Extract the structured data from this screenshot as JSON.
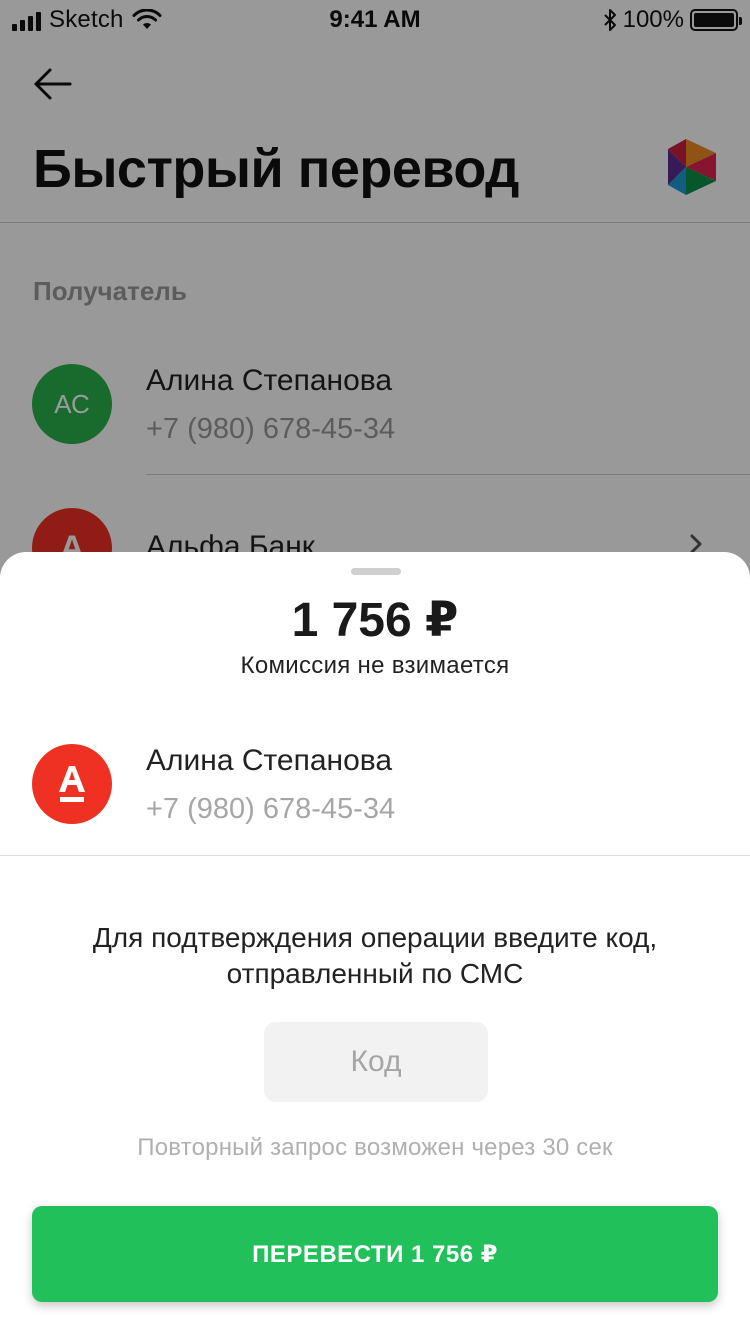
{
  "status_bar": {
    "carrier": "Sketch",
    "time": "9:41 AM",
    "battery": "100%"
  },
  "header": {
    "title": "Быстрый перевод",
    "back_icon": "arrow-left-icon",
    "logo_icon": "sbp-logo-icon"
  },
  "recipients": {
    "section_label": "Получатель",
    "items": [
      {
        "initials": "АС",
        "name": "Алина Степанова",
        "phone": "+7 (980) 678-45-34",
        "avatar_color": "#2bb24c"
      },
      {
        "initials": "А",
        "name": "Альфа Банк",
        "avatar_color": "#ef3124"
      }
    ]
  },
  "sheet": {
    "amount": "1 756 ₽",
    "commission": "Комиссия не взимается",
    "recipient": {
      "name": "Алина Степанова",
      "phone": "+7 (980) 678-45-34",
      "bank_icon": "alfa-bank-logo-icon"
    },
    "instruction": "Для подтверждения операции введите код, отправленный по СМС",
    "code_input": {
      "placeholder": "Код",
      "value": ""
    },
    "resend_text": "Повторный запрос возможен через 30 сек",
    "submit_label": "ПЕРЕВЕСТИ 1 756 ₽"
  },
  "colors": {
    "accent_green": "#22c05a",
    "alfa_red": "#ef3124",
    "overlay": "rgba(0,0,0,0.40)"
  }
}
